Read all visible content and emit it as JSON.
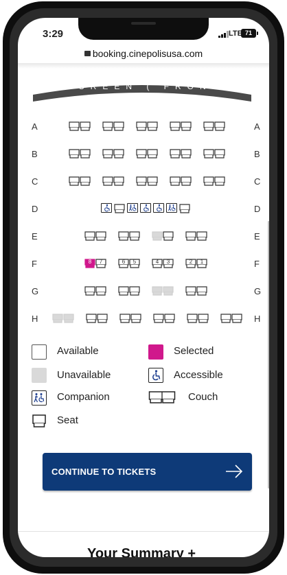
{
  "status_bar": {
    "time": "3:29",
    "network": "LTE",
    "battery": "71"
  },
  "browser": {
    "url": "booking.cinepolisusa.com"
  },
  "screen_label": "SCREEN ( FRONT )",
  "rows": [
    {
      "label": "A",
      "seats": []
    },
    {
      "label": "B",
      "seats": []
    },
    {
      "label": "C",
      "seats": []
    },
    {
      "label": "D",
      "seats": []
    },
    {
      "label": "E",
      "seats": []
    },
    {
      "label": "F",
      "seats": [
        {
          "number": "8",
          "status": "selected"
        },
        {
          "number": "7",
          "status": "available"
        },
        {
          "number": "6",
          "status": "available"
        },
        {
          "number": "5",
          "status": "available"
        },
        {
          "number": "4",
          "status": "available"
        },
        {
          "number": "3",
          "status": "available"
        },
        {
          "number": "2",
          "status": "available"
        },
        {
          "number": "1",
          "status": "available"
        }
      ]
    },
    {
      "label": "G",
      "seats": []
    },
    {
      "label": "H",
      "seats": []
    }
  ],
  "legend": {
    "available": "Available",
    "selected": "Selected",
    "unavailable": "Unavailable",
    "accessible": "Accessible",
    "companion": "Companion",
    "couch": "Couch",
    "seat": "Seat"
  },
  "cta": {
    "label": "CONTINUE TO TICKETS",
    "icon": "arrow-right-icon"
  },
  "summary": {
    "title": "Your Summary +"
  },
  "colors": {
    "selected": "#d0188c",
    "unavailable": "#d9d9d9",
    "accessible_icon": "#1e3f8f",
    "cta": "#0e3a78",
    "screen_arc": "#4a4a4a"
  }
}
